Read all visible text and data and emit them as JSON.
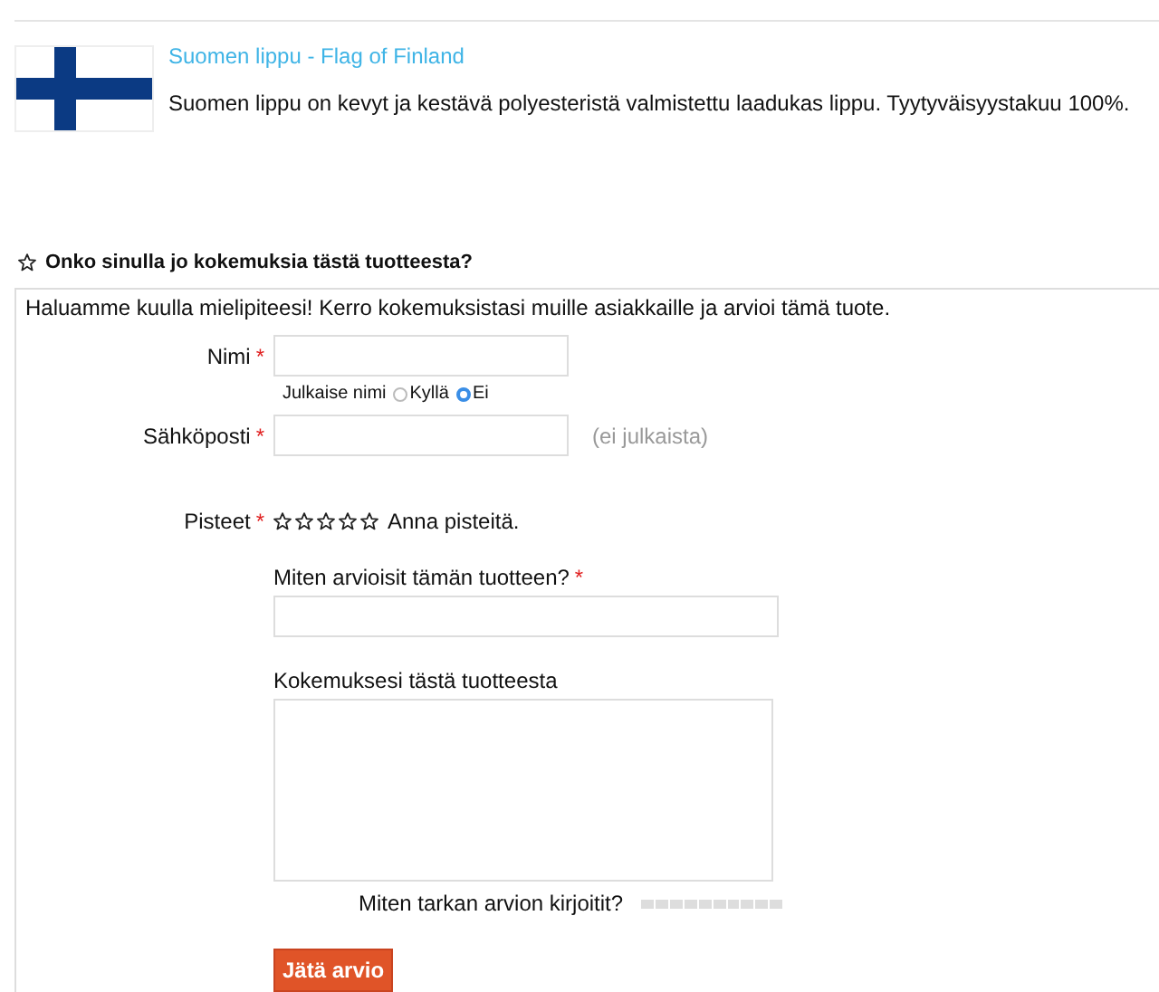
{
  "product": {
    "title": "Suomen lippu - Flag of Finland",
    "description": "Suomen lippu on kevyt ja kestävä polyesteristä valmistettu laadukas lippu. Tyytyväisyystakuu 100%."
  },
  "review": {
    "heading": "Onko sinulla jo kokemuksia tästä tuotteesta?",
    "intro": "Haluamme kuulla mielipiteesi! Kerro kokemuksistasi muille asiakkaille ja arvioi tämä tuote.",
    "name": {
      "label": "Nimi",
      "required_mark": "*"
    },
    "publish": {
      "label": "Julkaise nimi",
      "options": [
        {
          "label": "Kyllä",
          "selected": false
        },
        {
          "label": "Ei",
          "selected": true
        }
      ]
    },
    "email": {
      "label": "Sähköposti",
      "required_mark": "*",
      "note": "(ei julkaista)"
    },
    "rating": {
      "label": "Pisteet",
      "required_mark": "*",
      "stars": 0,
      "hint": "Anna pisteitä."
    },
    "summary": {
      "label": "Miten arvioisit tämän tuotteen?",
      "required_mark": "*"
    },
    "body": {
      "label": "Kokemuksesi tästä tuotteesta"
    },
    "detail": {
      "label": "Miten tarkan arvion kirjoitit?"
    },
    "submit": "Jätä arvio"
  }
}
